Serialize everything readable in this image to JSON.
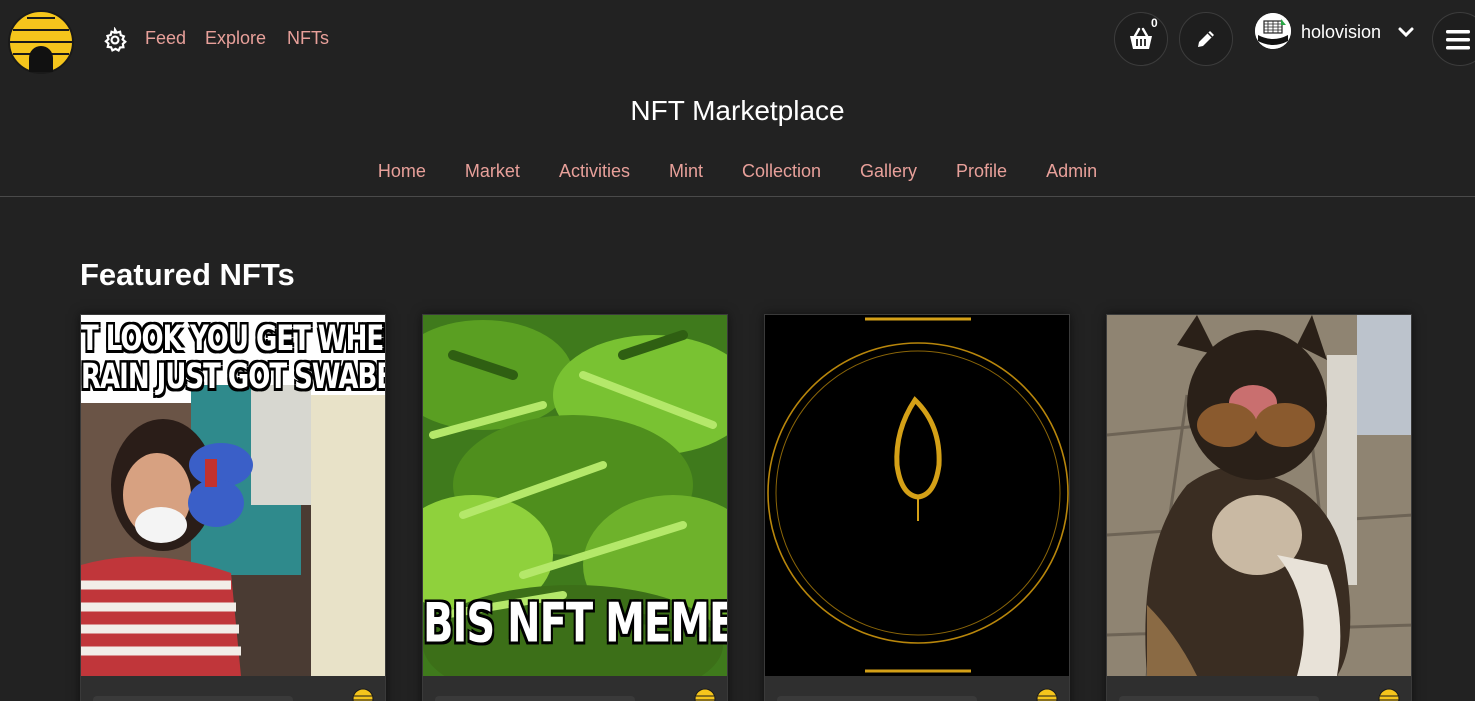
{
  "topnav": {
    "links": [
      "Feed",
      "Explore",
      "NFTs"
    ],
    "cart_count": "0",
    "username": "holovision"
  },
  "page": {
    "title": "NFT Marketplace"
  },
  "subnav": {
    "links": [
      "Home",
      "Market",
      "Activities",
      "Mint",
      "Collection",
      "Gallery",
      "Profile",
      "Admin"
    ]
  },
  "featured": {
    "title": "Featured NFTs",
    "cards": [
      {
        "caption_top_line1": "T LOOK YOU GET WHEN Y",
        "caption_top_line2": "RAIN JUST GOT SWABBE"
      },
      {
        "caption_bottom": "BIS NFT MEME ("
      },
      {},
      {}
    ]
  },
  "icons": {
    "logo": "beehive-logo-icon",
    "settings": "gear-icon",
    "cart": "basket-icon",
    "edit": "pencil-icon",
    "dropdown": "chevron-down-icon",
    "menu": "hamburger-menu-icon",
    "coin": "hive-coin-icon"
  },
  "colors": {
    "background": "#222222",
    "link": "#e8a09a",
    "text": "#ffffff",
    "accent": "#f5c51c"
  }
}
